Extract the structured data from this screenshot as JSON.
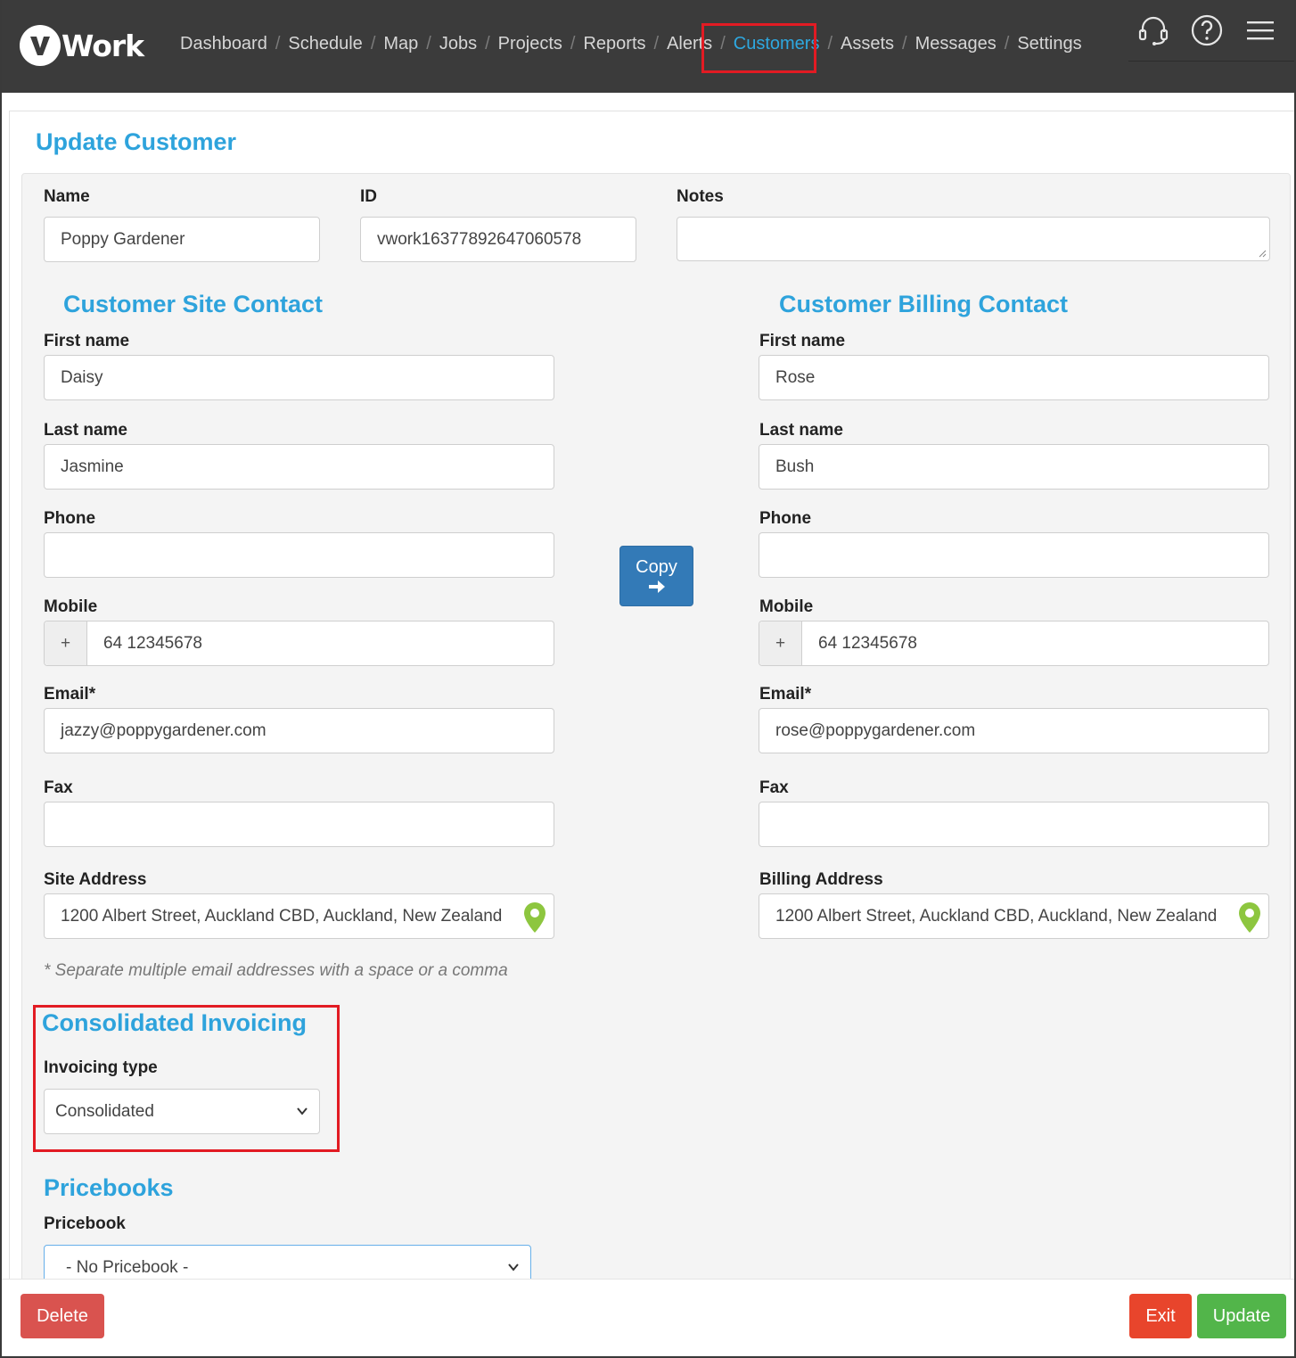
{
  "app": {
    "logo_text": "Work"
  },
  "nav": {
    "items": [
      {
        "label": "Dashboard"
      },
      {
        "label": "Schedule"
      },
      {
        "label": "Map"
      },
      {
        "label": "Jobs"
      },
      {
        "label": "Projects"
      },
      {
        "label": "Reports"
      },
      {
        "label": "Alerts"
      },
      {
        "label": "Customers",
        "active": true
      },
      {
        "label": "Assets"
      },
      {
        "label": "Messages"
      },
      {
        "label": "Settings"
      }
    ],
    "separator": "/",
    "icons": [
      "headset-icon",
      "help-icon",
      "menu-icon"
    ]
  },
  "page": {
    "title": "Update Customer"
  },
  "customer": {
    "name_label": "Name",
    "name_value": "Poppy Gardener",
    "id_label": "ID",
    "id_value": "vwork16377892647060578",
    "notes_label": "Notes",
    "notes_value": ""
  },
  "site_contact": {
    "heading": "Customer Site Contact",
    "first_name_label": "First name",
    "first_name": "Daisy",
    "last_name_label": "Last name",
    "last_name": "Jasmine",
    "phone_label": "Phone",
    "phone": "",
    "mobile_label": "Mobile",
    "mobile_prefix": "+",
    "mobile": "64 12345678",
    "email_label": "Email*",
    "email": "jazzy@poppygardener.com",
    "fax_label": "Fax",
    "fax": "",
    "address_label": "Site Address",
    "address": "1200 Albert Street, Auckland CBD, Auckland, New Zealand"
  },
  "billing_contact": {
    "heading": "Customer Billing Contact",
    "first_name_label": "First name",
    "first_name": "Rose",
    "last_name_label": "Last name",
    "last_name": "Bush",
    "phone_label": "Phone",
    "phone": "",
    "mobile_label": "Mobile",
    "mobile_prefix": "+",
    "mobile": "64 12345678",
    "email_label": "Email*",
    "email": "rose@poppygardener.com",
    "fax_label": "Fax",
    "fax": "",
    "address_label": "Billing Address",
    "address": "1200 Albert Street, Auckland CBD, Auckland, New Zealand"
  },
  "copy_button": {
    "label": "Copy",
    "icon": "arrow-right-icon"
  },
  "hint": "* Separate multiple email addresses with a space or a comma",
  "invoicing": {
    "heading": "Consolidated Invoicing",
    "type_label": "Invoicing type",
    "type_value": "Consolidated"
  },
  "pricebooks": {
    "heading": "Pricebooks",
    "pricebook_label": "Pricebook",
    "pricebook_value": "- No Pricebook -"
  },
  "footer": {
    "delete_label": "Delete",
    "exit_label": "Exit",
    "update_label": "Update"
  },
  "colors": {
    "navbar": "#3b3b3b",
    "accent": "#2ea3dc",
    "highlight": "#e21b23",
    "delete": "#d9534f",
    "exit": "#e8452c",
    "update": "#52b54a",
    "copy": "#337ab7",
    "pin": "#8dc63f"
  }
}
